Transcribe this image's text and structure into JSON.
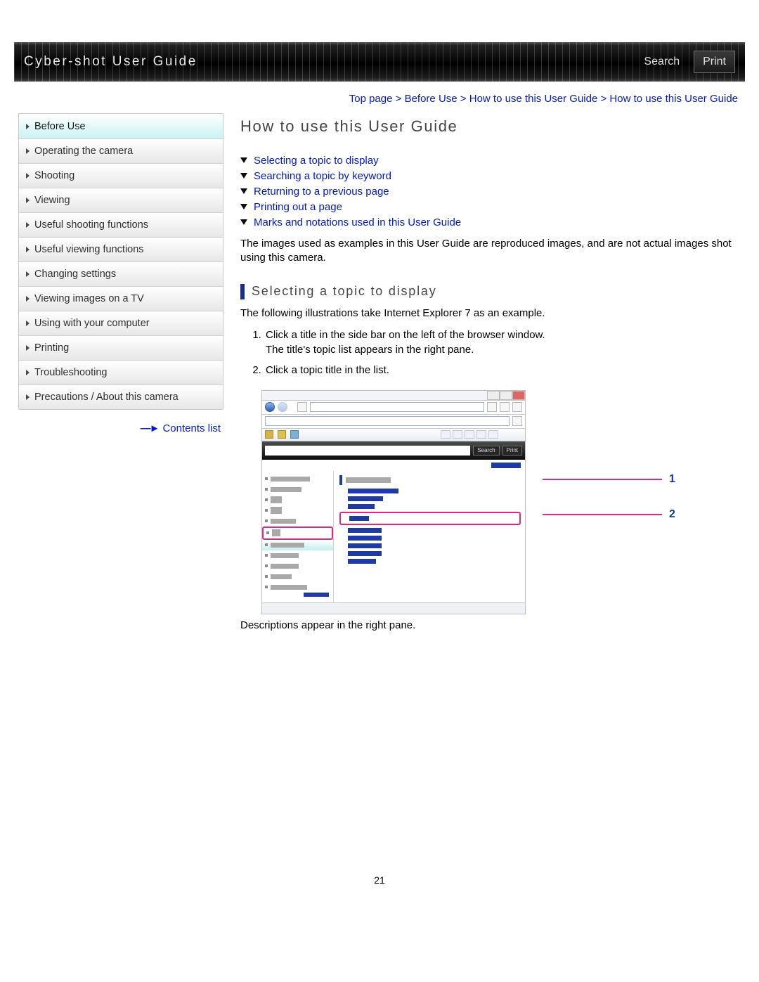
{
  "header": {
    "title": "Cyber-shot User Guide",
    "search_label": "Search",
    "print_label": "Print"
  },
  "breadcrumb": {
    "items": [
      "Top page",
      "Before Use",
      "How to use this User Guide",
      "How to use this User Guide"
    ],
    "sep": " > "
  },
  "sidebar": {
    "items": [
      "Before Use",
      "Operating the camera",
      "Shooting",
      "Viewing",
      "Useful shooting functions",
      "Useful viewing functions",
      "Changing settings",
      "Viewing images on a TV",
      "Using with your computer",
      "Printing",
      "Troubleshooting",
      "Precautions / About this camera"
    ],
    "active_index": 0,
    "contents_link": "Contents list"
  },
  "main": {
    "title": "How to use this User Guide",
    "jump_links": [
      "Selecting a topic to display",
      "Searching a topic by keyword",
      "Returning to a previous page",
      "Printing out a page",
      "Marks and notations used in this User Guide"
    ],
    "intro": "The images used as examples in this User Guide are reproduced images, and are not actual images shot using this camera.",
    "section1": {
      "title": "Selecting a topic to display",
      "lead": "The following illustrations take Internet Explorer 7 as an example.",
      "steps": [
        "Click a title in the side bar on the left of the browser window.\nThe title's topic list appears in the right pane.",
        "Click a topic title in the list."
      ],
      "callouts": [
        "1",
        "2"
      ],
      "after": "Descriptions appear in the right pane."
    }
  },
  "illustration": {
    "buttons": {
      "search": "Search",
      "print": "Print"
    }
  },
  "page_number": "21"
}
